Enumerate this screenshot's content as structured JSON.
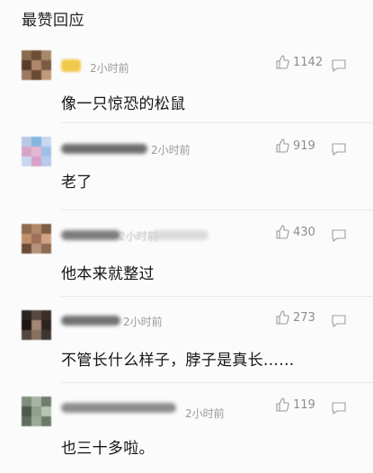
{
  "section": {
    "title": "最赞回应"
  },
  "comments": [
    {
      "time": "2小时前",
      "likes": "1142",
      "text": "像一只惊恐的松鼠"
    },
    {
      "time": "2小时前",
      "likes": "919",
      "text": "老了"
    },
    {
      "time": "2小时前",
      "likes": "430",
      "text": "他本来就整过"
    },
    {
      "time": "2小时前",
      "likes": "273",
      "text": "不管长什么样子，脖子是真长……"
    },
    {
      "time": "2小时前",
      "likes": "119",
      "text": "也三十多啦。"
    }
  ],
  "icons": {
    "like": "thumbs-up-icon",
    "reply": "comment-icon"
  }
}
